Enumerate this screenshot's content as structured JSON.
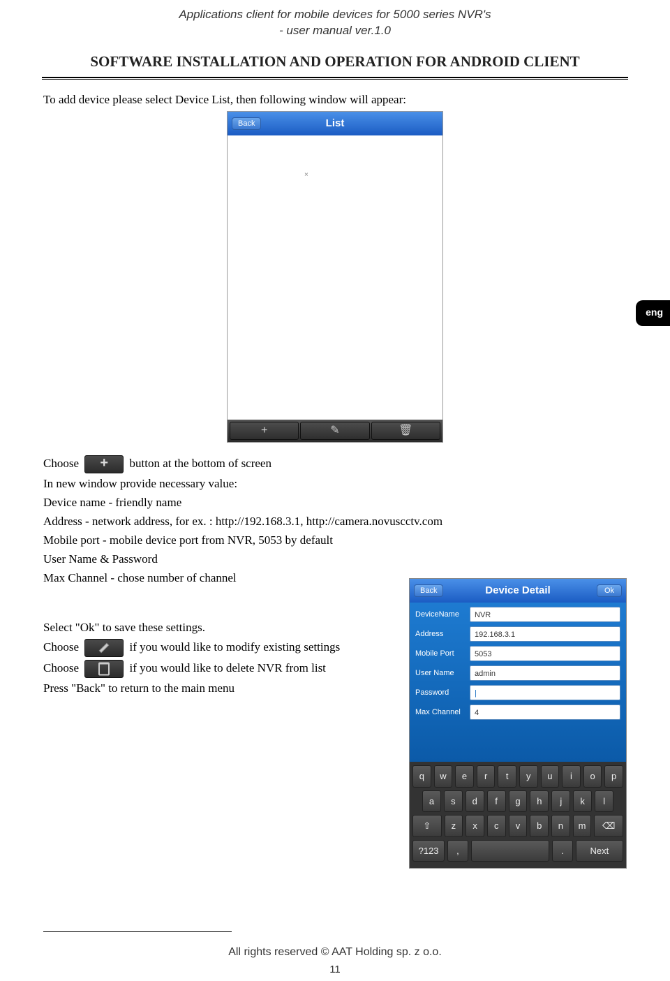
{
  "header": {
    "line1": "Applications client for mobile devices for 5000 series NVR's",
    "line2": "- user manual ver.1.0"
  },
  "section_heading": "SOFTWARE INSTALLATION AND OPERATION FOR ANDROID CLIENT",
  "lang_tab": "eng",
  "body": {
    "p1": "To add device please select Device List, then following window will appear:",
    "choose_prefix": "Choose",
    "choose_suffix": "button at the bottom of screen",
    "p3": "In new window provide necessary value:",
    "p4": "Device name - friendly name",
    "p5": "Address - network address, for ex. : http://192.168.3.1, http://camera.novuscctv.com",
    "p6": "Mobile port - mobile device port from NVR, 5053 by default",
    "p7": "User Name & Password",
    "p8": "Max Channel - chose number of channel",
    "p9": "Select \"Ok\" to save these settings.",
    "edit_suffix": "if you would like to modify existing settings",
    "delete_suffix": "if you would like to delete NVR from list",
    "p12": "Press \"Back\" to return to the main menu"
  },
  "phone1": {
    "back": "Back",
    "title": "List",
    "close_mark": "×",
    "bottom": {
      "add": "+",
      "edit": "✎",
      "delete": "🗑"
    }
  },
  "phone2": {
    "back": "Back",
    "title": "Device Detail",
    "ok": "Ok",
    "fields": {
      "deviceName": {
        "label": "DeviceName",
        "value": "NVR"
      },
      "address": {
        "label": "Address",
        "value": "192.168.3.1"
      },
      "mobilePort": {
        "label": "Mobile Port",
        "value": "5053"
      },
      "userName": {
        "label": "User Name",
        "value": "admin"
      },
      "password": {
        "label": "Password",
        "value": ""
      },
      "maxChannel": {
        "label": "Max Channel",
        "value": "4"
      }
    },
    "keyboard": {
      "r1": [
        "q",
        "w",
        "e",
        "r",
        "t",
        "y",
        "u",
        "i",
        "o",
        "p"
      ],
      "r2": [
        "a",
        "s",
        "d",
        "f",
        "g",
        "h",
        "j",
        "k",
        "l"
      ],
      "r3_shift": "⇧",
      "r3": [
        "z",
        "x",
        "c",
        "v",
        "b",
        "n",
        "m"
      ],
      "r3_bksp": "⌫",
      "r4": {
        "sym": "?123",
        "comma": ",",
        "space": " ",
        "dot": ".",
        "next": "Next"
      }
    }
  },
  "footer": "All rights reserved © AAT Holding sp. z o.o.",
  "page_number": "11"
}
